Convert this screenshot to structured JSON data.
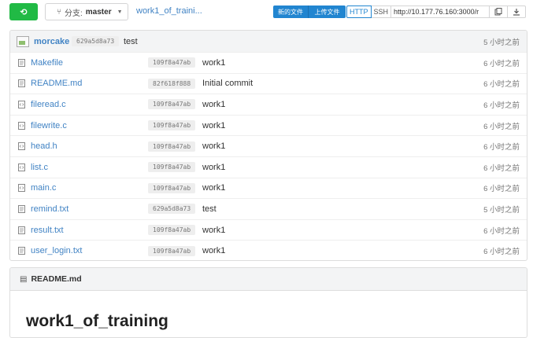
{
  "toolbar": {
    "sync_label": "⟲",
    "branch_prefix": "分支:",
    "branch_name": "master",
    "repo_crumb": "work1_of_traini...",
    "new_file_label": "新的文件",
    "upload_file_label": "上传文件",
    "http_label": "HTTP",
    "ssh_label": "SSH",
    "clone_url": "http://10.177.76.160:3000/r"
  },
  "latest_commit": {
    "author": "morcake",
    "sha": "629a5d8a73",
    "message": "test",
    "time": "5 小时之前"
  },
  "files": [
    {
      "name": "Makefile",
      "sha": "109f8a47ab",
      "message": "work1",
      "time": "6 小时之前",
      "icon": "file-text-icon"
    },
    {
      "name": "README.md",
      "sha": "82f618f888",
      "message": "Initial commit",
      "time": "6 小时之前",
      "icon": "file-text-icon"
    },
    {
      "name": "fileread.c",
      "sha": "109f8a47ab",
      "message": "work1",
      "time": "6 小时之前",
      "icon": "file-code-icon"
    },
    {
      "name": "filewrite.c",
      "sha": "109f8a47ab",
      "message": "work1",
      "time": "6 小时之前",
      "icon": "file-code-icon"
    },
    {
      "name": "head.h",
      "sha": "109f8a47ab",
      "message": "work1",
      "time": "6 小时之前",
      "icon": "file-code-icon"
    },
    {
      "name": "list.c",
      "sha": "109f8a47ab",
      "message": "work1",
      "time": "6 小时之前",
      "icon": "file-code-icon"
    },
    {
      "name": "main.c",
      "sha": "109f8a47ab",
      "message": "work1",
      "time": "6 小时之前",
      "icon": "file-code-icon"
    },
    {
      "name": "remind.txt",
      "sha": "629a5d8a73",
      "message": "test",
      "time": "5 小时之前",
      "icon": "file-text-icon"
    },
    {
      "name": "result.txt",
      "sha": "109f8a47ab",
      "message": "work1",
      "time": "6 小时之前",
      "icon": "file-text-icon"
    },
    {
      "name": "user_login.txt",
      "sha": "109f8a47ab",
      "message": "work1",
      "time": "6 小时之前",
      "icon": "file-text-icon"
    }
  ],
  "readme": {
    "header_label": "README.md",
    "heading": "work1_of_training"
  },
  "colors": {
    "accent_blue": "#2185d0",
    "link_blue": "#4183c4",
    "green": "#21ba45"
  }
}
